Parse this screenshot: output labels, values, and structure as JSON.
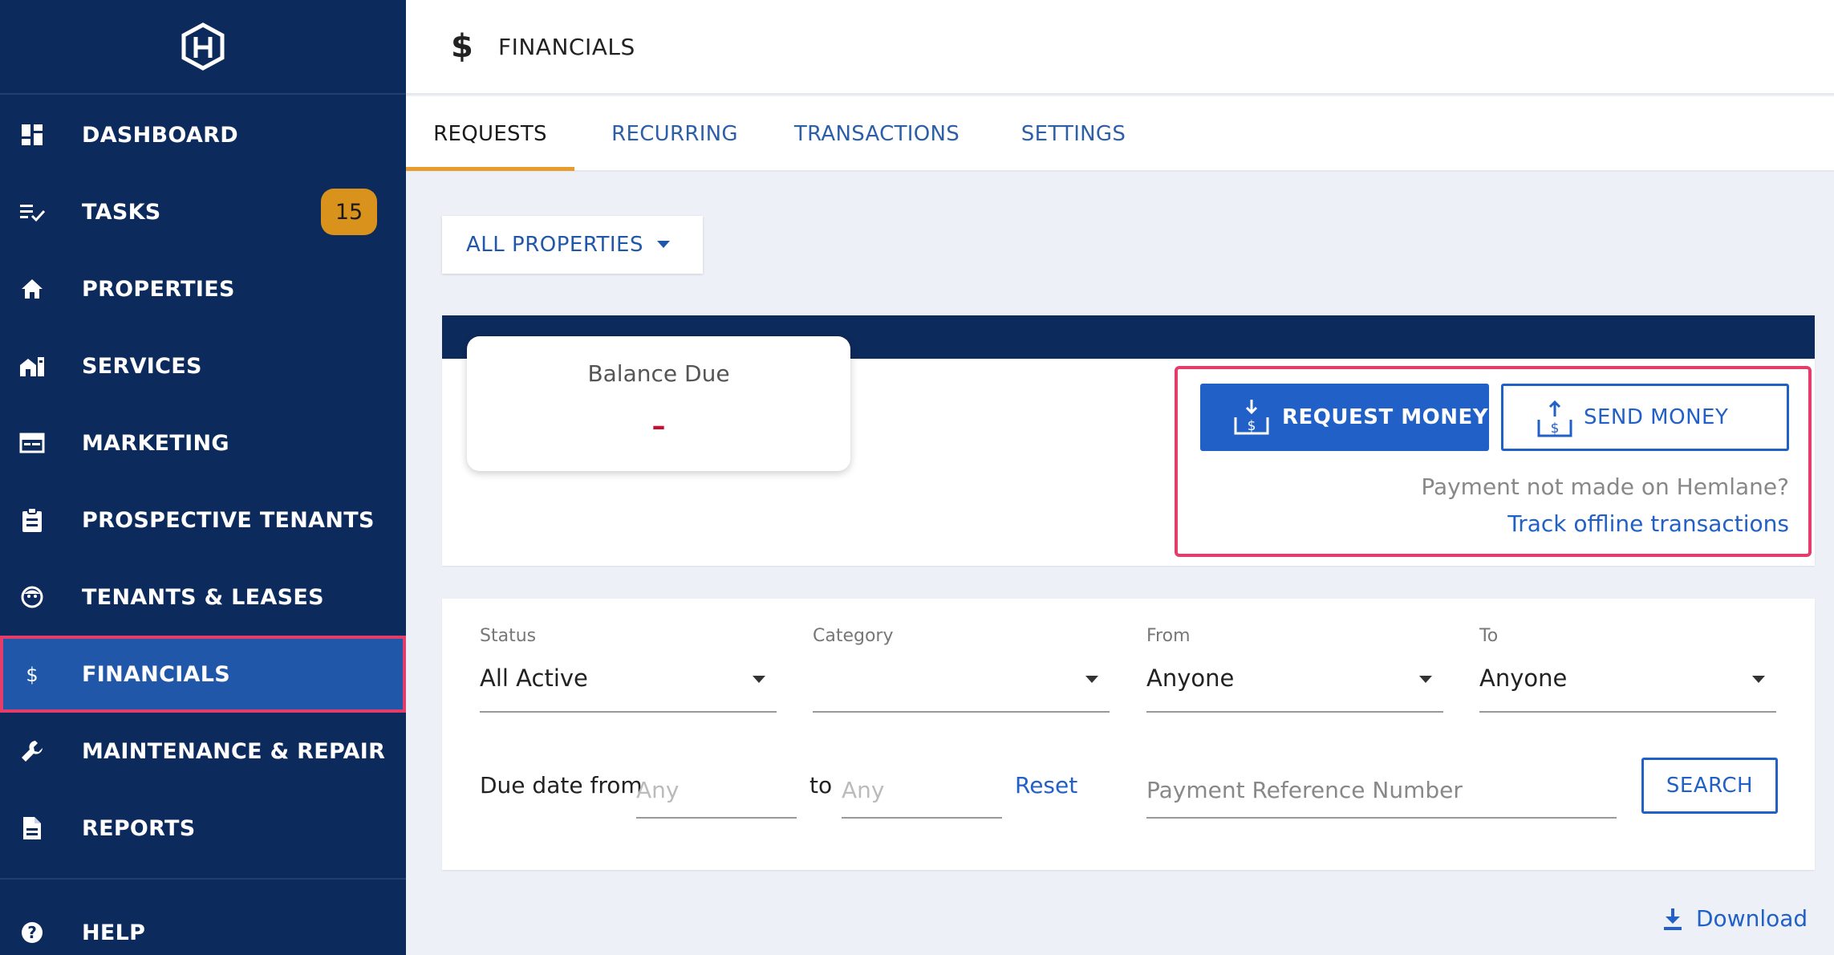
{
  "sidebar": {
    "items": [
      {
        "label": "DASHBOARD",
        "icon": "dashboard-icon"
      },
      {
        "label": "TASKS",
        "icon": "tasks-icon",
        "badge": "15"
      },
      {
        "label": "PROPERTIES",
        "icon": "home-icon"
      },
      {
        "label": "SERVICES",
        "icon": "services-icon"
      },
      {
        "label": "MARKETING",
        "icon": "marketing-icon"
      },
      {
        "label": "PROSPECTIVE TENANTS",
        "icon": "clipboard-icon"
      },
      {
        "label": "TENANTS & LEASES",
        "icon": "face-icon"
      },
      {
        "label": "FINANCIALS",
        "icon": "dollar-icon",
        "active": true
      },
      {
        "label": "MAINTENANCE & REPAIR",
        "icon": "wrench-icon"
      },
      {
        "label": "REPORTS",
        "icon": "document-icon"
      },
      {
        "label": "HELP",
        "icon": "help-icon"
      }
    ]
  },
  "header": {
    "icon_glyph": "$",
    "title": "FINANCIALS"
  },
  "tabs": [
    {
      "label": "REQUESTS",
      "active": true
    },
    {
      "label": "RECURRING"
    },
    {
      "label": "TRANSACTIONS"
    },
    {
      "label": "SETTINGS"
    }
  ],
  "properties_filter": {
    "label": "ALL PROPERTIES"
  },
  "balance": {
    "label": "Balance Due",
    "value": "–"
  },
  "actions": {
    "request_label": "REQUEST MONEY",
    "send_label": "SEND MONEY",
    "offline_question": "Payment not made on Hemlane?",
    "offline_link": "Track offline transactions"
  },
  "filters": {
    "status": {
      "label": "Status",
      "value": "All Active"
    },
    "category": {
      "label": "Category",
      "value": ""
    },
    "from": {
      "label": "From",
      "value": "Anyone"
    },
    "to": {
      "label": "To",
      "value": "Anyone"
    },
    "due_date_label": "Due date from",
    "due_from_placeholder": "Any",
    "to_label": "to",
    "due_to_placeholder": "Any",
    "reset_label": "Reset",
    "reference_placeholder": "Payment Reference Number",
    "search_label": "SEARCH"
  },
  "download_label": "Download",
  "colors": {
    "sidebar_bg": "#0d2a5c",
    "active_item": "#2157a8",
    "highlight_border": "#e43d6c",
    "accent_blue": "#2160c6",
    "badge": "#d9921c",
    "tab_underline": "#e89c2e"
  }
}
